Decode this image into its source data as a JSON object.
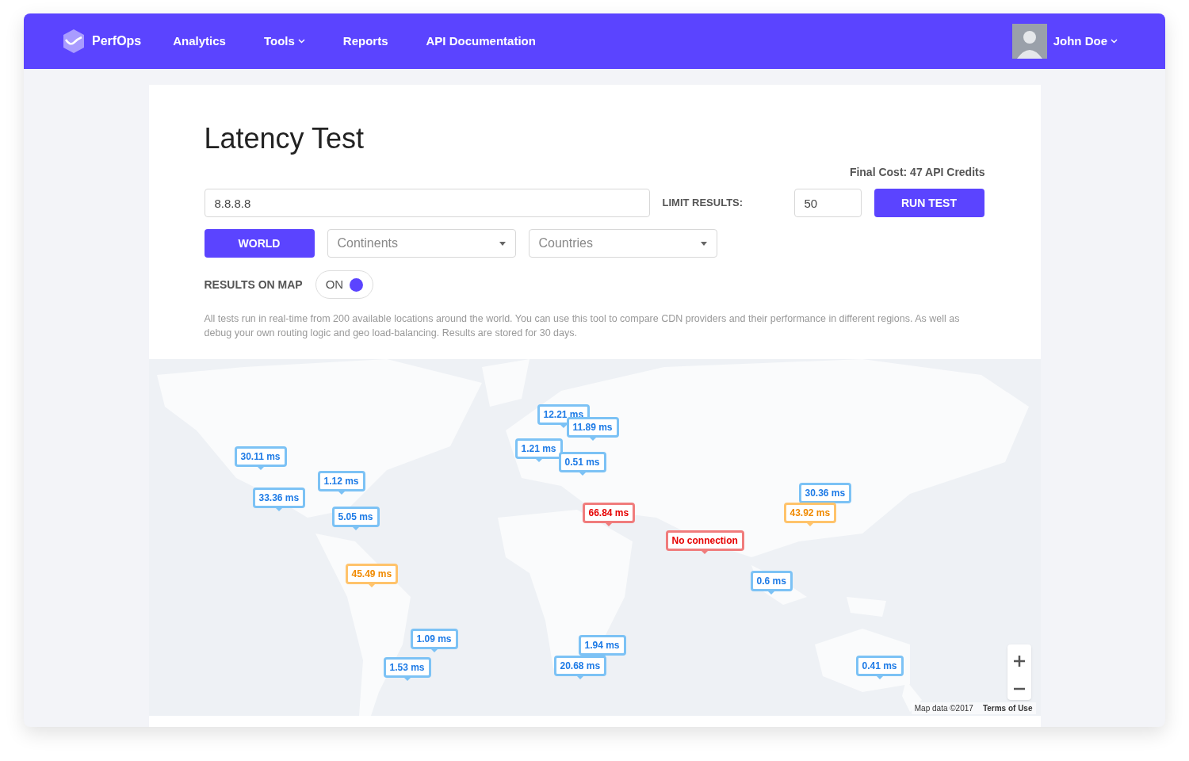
{
  "nav": {
    "brand": "PerfOps",
    "items": [
      {
        "label": "Analytics",
        "dropdown": false
      },
      {
        "label": "Tools",
        "dropdown": true
      },
      {
        "label": "Reports",
        "dropdown": false
      },
      {
        "label": "API Documentation",
        "dropdown": false
      }
    ],
    "user": {
      "name": "John Doe"
    }
  },
  "page": {
    "title": "Latency Test",
    "cost": "Final Cost: 47 API Credits",
    "target": {
      "value": "8.8.8.8"
    },
    "limit": {
      "label": "LIMIT RESULTS:",
      "value": "50"
    },
    "run_button": "RUN TEST",
    "scope": {
      "world": "WORLD",
      "continents": {
        "placeholder": "Continents"
      },
      "countries": {
        "placeholder": "Countries"
      }
    },
    "results_on_map": {
      "label": "RESULTS ON MAP",
      "state": "ON",
      "on": true
    },
    "description": "All tests run in real-time from 200 available locations around the world. You can use this tool to compare CDN providers and their performance in different regions. As well as debug your own routing logic and geo load-balancing. Results are stored for 30 days."
  },
  "map": {
    "kind": "picture",
    "markers": [
      {
        "text": "30.11 ms",
        "kind": "ok"
      },
      {
        "text": "1.12 ms",
        "kind": "ok"
      },
      {
        "text": "33.36 ms",
        "kind": "ok"
      },
      {
        "text": "5.05 ms",
        "kind": "ok"
      },
      {
        "text": "45.49 ms",
        "kind": "warn"
      },
      {
        "text": "1.09 ms",
        "kind": "ok"
      },
      {
        "text": "1.53 ms",
        "kind": "ok"
      },
      {
        "text": "12.21 ms",
        "kind": "ok"
      },
      {
        "text": "11.89 ms",
        "kind": "ok"
      },
      {
        "text": "1.21 ms",
        "kind": "ok"
      },
      {
        "text": "0.51 ms",
        "kind": "ok"
      },
      {
        "text": "66.84 ms",
        "kind": "fail"
      },
      {
        "text": "No connection",
        "kind": "fail"
      },
      {
        "text": "30.36 ms",
        "kind": "ok"
      },
      {
        "text": "43.92 ms",
        "kind": "warn"
      },
      {
        "text": "0.6 ms",
        "kind": "ok"
      },
      {
        "text": "0.41 ms",
        "kind": "ok"
      },
      {
        "text": "1.94 ms",
        "kind": "ok"
      },
      {
        "text": "20.68 ms",
        "kind": "ok"
      }
    ],
    "attribution": "Map data ©2017",
    "terms": "Terms of Use"
  }
}
